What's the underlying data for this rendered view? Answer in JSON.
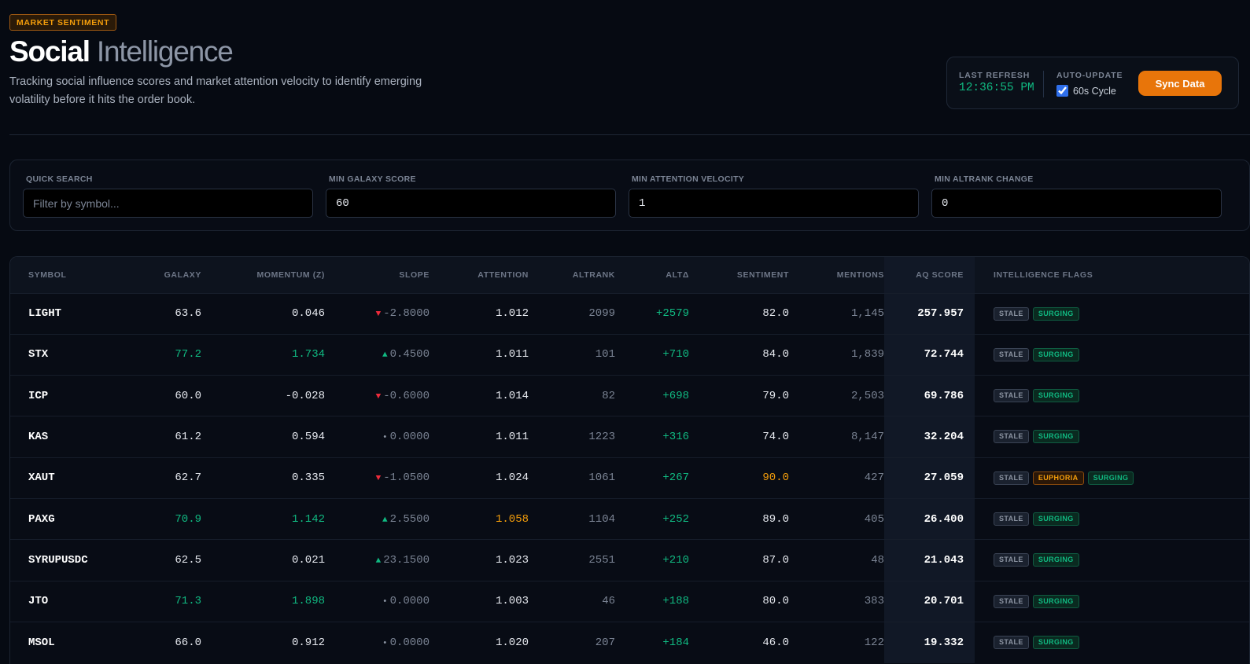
{
  "header": {
    "badge": "MARKET SENTIMENT",
    "title_main": "Social",
    "title_accent": "Intelligence",
    "subtitle": "Tracking social influence scores and market attention velocity to identify emerging volatility before it hits the order book."
  },
  "status": {
    "last_refresh_label": "LAST REFRESH",
    "last_refresh_time": "12:36:55 PM",
    "auto_update_label": "AUTO-UPDATE",
    "auto_update_option": "60s Cycle",
    "auto_update_checked": true,
    "sync_button": "Sync Data"
  },
  "filters": {
    "search_label": "QUICK SEARCH",
    "search_placeholder": "Filter by symbol...",
    "search_value": "",
    "galaxy_label": "MIN GALAXY SCORE",
    "galaxy_value": "60",
    "velocity_label": "MIN ATTENTION VELOCITY",
    "velocity_value": "1",
    "altrank_label": "MIN ALTRANK CHANGE",
    "altrank_value": "0"
  },
  "table": {
    "columns": {
      "symbol": "SYMBOL",
      "galaxy": "GALAXY",
      "momentum": "MOMENTUM (Z)",
      "slope": "SLOPE",
      "attention": "ATTENTION",
      "altrank": "ALTRANK",
      "altdelta": "ALTΔ",
      "sentiment": "SENTIMENT",
      "mentions": "MENTIONS",
      "aq": "AQ SCORE",
      "flags": "INTELLIGENCE FLAGS"
    },
    "rows": [
      {
        "symbol": "LIGHT",
        "galaxy": "63.6",
        "galaxy_hl": false,
        "momentum": "0.046",
        "momentum_hl": false,
        "slope_dir": "down",
        "slope": "-2.8000",
        "attention": "1.012",
        "attention_hl": false,
        "altrank": "2099",
        "altdelta": "+2579",
        "sentiment": "82.0",
        "sentiment_hl": false,
        "mentions": "1,145",
        "aq": "257.957",
        "flags": [
          "STALE",
          "SURGING"
        ]
      },
      {
        "symbol": "STX",
        "galaxy": "77.2",
        "galaxy_hl": true,
        "momentum": "1.734",
        "momentum_hl": true,
        "slope_dir": "up",
        "slope": "0.4500",
        "attention": "1.011",
        "attention_hl": false,
        "altrank": "101",
        "altdelta": "+710",
        "sentiment": "84.0",
        "sentiment_hl": false,
        "mentions": "1,839",
        "aq": "72.744",
        "flags": [
          "STALE",
          "SURGING"
        ]
      },
      {
        "symbol": "ICP",
        "galaxy": "60.0",
        "galaxy_hl": false,
        "momentum": "-0.028",
        "momentum_hl": false,
        "slope_dir": "down",
        "slope": "-0.6000",
        "attention": "1.014",
        "attention_hl": false,
        "altrank": "82",
        "altdelta": "+698",
        "sentiment": "79.0",
        "sentiment_hl": false,
        "mentions": "2,503",
        "aq": "69.786",
        "flags": [
          "STALE",
          "SURGING"
        ]
      },
      {
        "symbol": "KAS",
        "galaxy": "61.2",
        "galaxy_hl": false,
        "momentum": "0.594",
        "momentum_hl": false,
        "slope_dir": "flat",
        "slope": "0.0000",
        "attention": "1.011",
        "attention_hl": false,
        "altrank": "1223",
        "altdelta": "+316",
        "sentiment": "74.0",
        "sentiment_hl": false,
        "mentions": "8,147",
        "aq": "32.204",
        "flags": [
          "STALE",
          "SURGING"
        ]
      },
      {
        "symbol": "XAUT",
        "galaxy": "62.7",
        "galaxy_hl": false,
        "momentum": "0.335",
        "momentum_hl": false,
        "slope_dir": "down",
        "slope": "-1.0500",
        "attention": "1.024",
        "attention_hl": false,
        "altrank": "1061",
        "altdelta": "+267",
        "sentiment": "90.0",
        "sentiment_hl": true,
        "mentions": "427",
        "aq": "27.059",
        "flags": [
          "STALE",
          "EUPHORIA",
          "SURGING"
        ]
      },
      {
        "symbol": "PAXG",
        "galaxy": "70.9",
        "galaxy_hl": true,
        "momentum": "1.142",
        "momentum_hl": true,
        "slope_dir": "up",
        "slope": "2.5500",
        "attention": "1.058",
        "attention_hl": true,
        "altrank": "1104",
        "altdelta": "+252",
        "sentiment": "89.0",
        "sentiment_hl": false,
        "mentions": "405",
        "aq": "26.400",
        "flags": [
          "STALE",
          "SURGING"
        ]
      },
      {
        "symbol": "SYRUPUSDC",
        "galaxy": "62.5",
        "galaxy_hl": false,
        "momentum": "0.021",
        "momentum_hl": false,
        "slope_dir": "up",
        "slope": "23.1500",
        "attention": "1.023",
        "attention_hl": false,
        "altrank": "2551",
        "altdelta": "+210",
        "sentiment": "87.0",
        "sentiment_hl": false,
        "mentions": "48",
        "aq": "21.043",
        "flags": [
          "STALE",
          "SURGING"
        ]
      },
      {
        "symbol": "JTO",
        "galaxy": "71.3",
        "galaxy_hl": true,
        "momentum": "1.898",
        "momentum_hl": true,
        "slope_dir": "flat",
        "slope": "0.0000",
        "attention": "1.003",
        "attention_hl": false,
        "altrank": "46",
        "altdelta": "+188",
        "sentiment": "80.0",
        "sentiment_hl": false,
        "mentions": "383",
        "aq": "20.701",
        "flags": [
          "STALE",
          "SURGING"
        ]
      },
      {
        "symbol": "MSOL",
        "galaxy": "66.0",
        "galaxy_hl": false,
        "momentum": "0.912",
        "momentum_hl": false,
        "slope_dir": "flat",
        "slope": "0.0000",
        "attention": "1.020",
        "attention_hl": false,
        "altrank": "207",
        "altdelta": "+184",
        "sentiment": "46.0",
        "sentiment_hl": false,
        "mentions": "122",
        "aq": "19.332",
        "flags": [
          "STALE",
          "SURGING"
        ]
      }
    ]
  }
}
